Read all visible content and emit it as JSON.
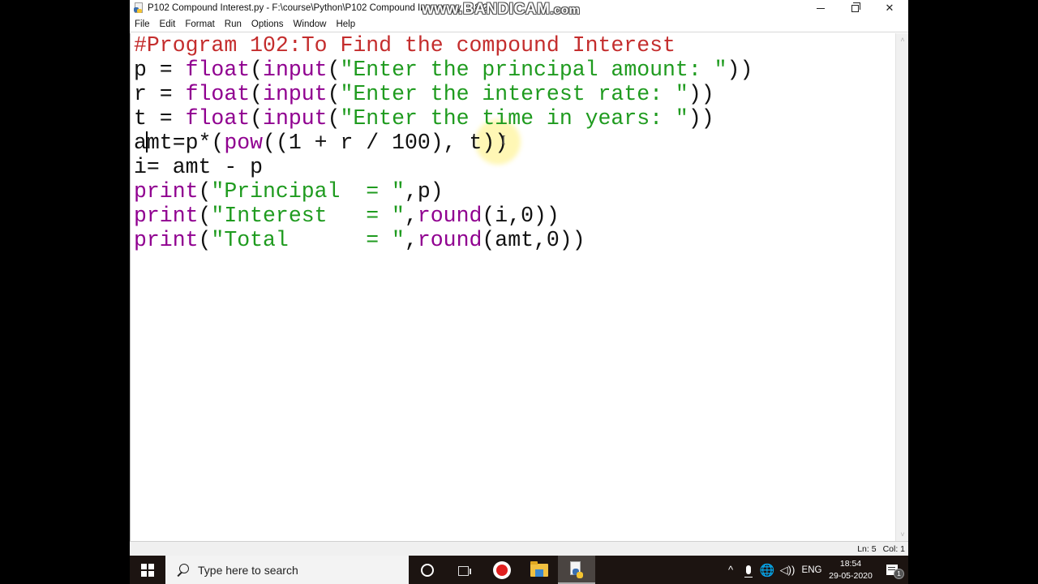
{
  "window": {
    "title": "P102 Compound Interest.py - F:\\course\\Python\\P102 Compound Interest.py (3.8.2)",
    "watermark_main": "www.BANDICAM",
    "watermark_suffix": ".com",
    "controls": {
      "minimize": "minimize",
      "maximize": "restore",
      "close": "✕"
    }
  },
  "menu": [
    "File",
    "Edit",
    "Format",
    "Run",
    "Options",
    "Window",
    "Help"
  ],
  "editor": {
    "colors": {
      "comment": "#c42d2d",
      "builtin": "#900090",
      "string": "#1f9b1f",
      "default": "#111111"
    },
    "lines": [
      [
        {
          "t": "#Program 102:To Find the compound Interest",
          "k": "comment"
        }
      ],
      [
        {
          "t": "p = ",
          "k": "default"
        },
        {
          "t": "float",
          "k": "builtin"
        },
        {
          "t": "(",
          "k": "default"
        },
        {
          "t": "input",
          "k": "builtin"
        },
        {
          "t": "(",
          "k": "default"
        },
        {
          "t": "\"Enter the principal amount: \"",
          "k": "string"
        },
        {
          "t": "))",
          "k": "default"
        }
      ],
      [
        {
          "t": "r = ",
          "k": "default"
        },
        {
          "t": "float",
          "k": "builtin"
        },
        {
          "t": "(",
          "k": "default"
        },
        {
          "t": "input",
          "k": "builtin"
        },
        {
          "t": "(",
          "k": "default"
        },
        {
          "t": "\"Enter the interest rate: \"",
          "k": "string"
        },
        {
          "t": "))",
          "k": "default"
        }
      ],
      [
        {
          "t": "t = ",
          "k": "default"
        },
        {
          "t": "float",
          "k": "builtin"
        },
        {
          "t": "(",
          "k": "default"
        },
        {
          "t": "input",
          "k": "builtin"
        },
        {
          "t": "(",
          "k": "default"
        },
        {
          "t": "\"Enter the time in years: \"",
          "k": "string"
        },
        {
          "t": "))",
          "k": "default"
        }
      ],
      [
        {
          "t": "a",
          "k": "default"
        },
        {
          "t": "",
          "k": "cursor"
        },
        {
          "t": "mt=p*(",
          "k": "default"
        },
        {
          "t": "pow",
          "k": "builtin"
        },
        {
          "t": "((1 + r / 100), t))",
          "k": "default"
        }
      ],
      [
        {
          "t": "i= amt - p",
          "k": "default"
        }
      ],
      [
        {
          "t": "print",
          "k": "builtin"
        },
        {
          "t": "(",
          "k": "default"
        },
        {
          "t": "\"Principal  = \"",
          "k": "string"
        },
        {
          "t": ",p)",
          "k": "default"
        }
      ],
      [
        {
          "t": "print",
          "k": "builtin"
        },
        {
          "t": "(",
          "k": "default"
        },
        {
          "t": "\"Interest   = \"",
          "k": "string"
        },
        {
          "t": ",",
          "k": "default"
        },
        {
          "t": "round",
          "k": "builtin"
        },
        {
          "t": "(i,0))",
          "k": "default"
        }
      ],
      [
        {
          "t": "print",
          "k": "builtin"
        },
        {
          "t": "(",
          "k": "default"
        },
        {
          "t": "\"Total      = \"",
          "k": "string"
        },
        {
          "t": ",",
          "k": "default"
        },
        {
          "t": "round",
          "k": "builtin"
        },
        {
          "t": "(amt,0))",
          "k": "default"
        }
      ]
    ],
    "mouse_pointer": "I"
  },
  "scrollbar": {
    "up": "˄",
    "down": "˅"
  },
  "status": {
    "line": "Ln: 5",
    "col": "Col: 1"
  },
  "taskbar": {
    "search_placeholder": "Type here to search",
    "apps": [
      "cortana",
      "task-view",
      "bandicam",
      "file-explorer",
      "python-idle"
    ],
    "tray": {
      "chevron": "^",
      "network": "🌐",
      "volume": "◁))",
      "language": "ENG",
      "time": "18:54",
      "date": "29-05-2020",
      "notifications": "1"
    }
  }
}
